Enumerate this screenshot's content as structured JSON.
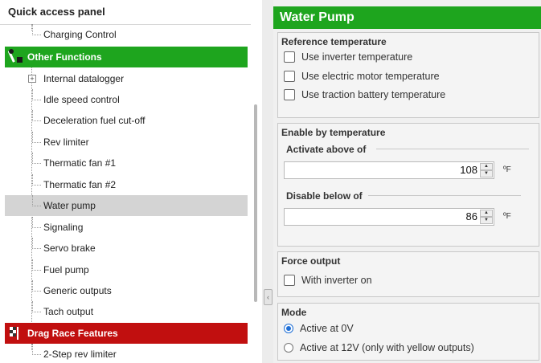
{
  "left_panel": {
    "title": "Quick access panel",
    "top_item": "Charging Control",
    "categories": [
      {
        "label": "Other Functions",
        "color": "#1ea51e",
        "icon": "wrench-icon",
        "items": [
          {
            "label": "Internal datalogger",
            "expandable": true
          },
          {
            "label": "Idle speed control"
          },
          {
            "label": "Deceleration fuel cut-off"
          },
          {
            "label": "Rev limiter"
          },
          {
            "label": "Thermatic fan #1"
          },
          {
            "label": "Thermatic fan #2"
          },
          {
            "label": "Water pump",
            "selected": true
          },
          {
            "label": "Signaling"
          },
          {
            "label": "Servo brake"
          },
          {
            "label": "Fuel pump"
          },
          {
            "label": "Generic outputs"
          },
          {
            "label": "Tach output"
          }
        ]
      },
      {
        "label": "Drag Race Features",
        "color": "#c10f0f",
        "icon": "drag-race-icon",
        "items": [
          {
            "label": "2-Step rev limiter"
          }
        ]
      }
    ]
  },
  "right_panel": {
    "title": "Water Pump",
    "reference_temperature": {
      "title": "Reference temperature",
      "options": [
        "Use inverter temperature",
        "Use electric motor temperature",
        "Use traction battery temperature"
      ]
    },
    "enable_by_temperature": {
      "title": "Enable by temperature",
      "activate_label": "Activate above of",
      "activate_value": "108",
      "disable_label": "Disable below of",
      "disable_value": "86",
      "unit": "ºF"
    },
    "force_output": {
      "title": "Force output",
      "option": "With inverter on"
    },
    "mode": {
      "title": "Mode",
      "options": [
        "Active at 0V",
        "Active at 12V (only with yellow outputs)"
      ],
      "selected": 0
    }
  },
  "colors": {
    "accent_green": "#1ea51e",
    "accent_red": "#c10f0f",
    "selection": "#d4d4d4"
  }
}
